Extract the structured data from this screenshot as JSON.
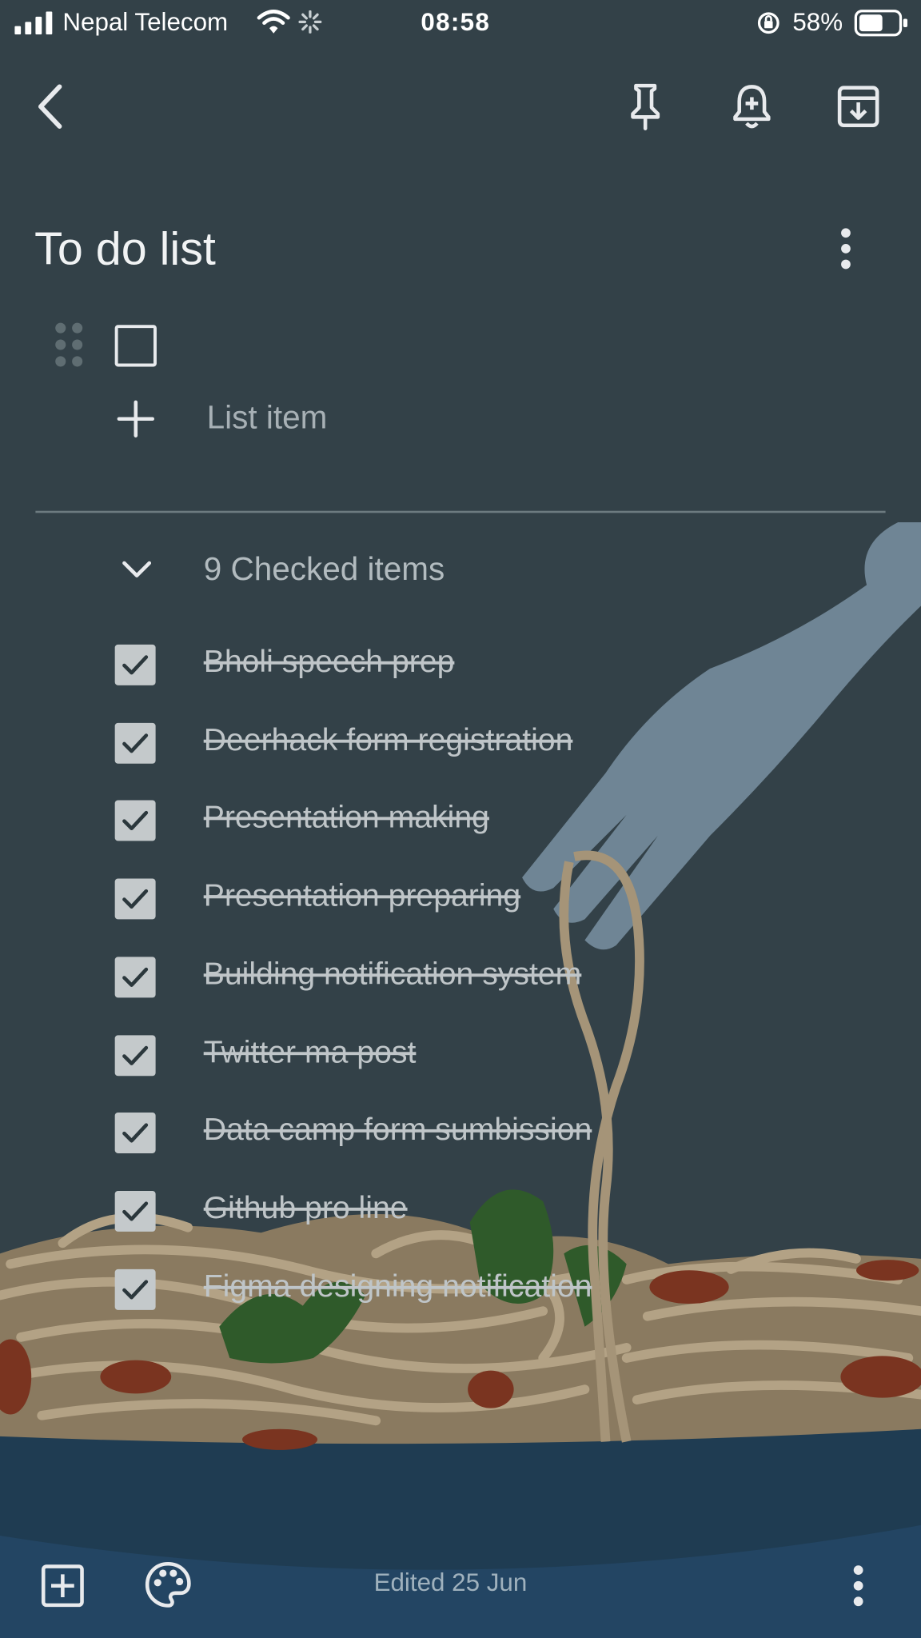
{
  "status_bar": {
    "carrier": "Nepal Telecom",
    "time": "08:58",
    "battery": "58%"
  },
  "toolbar": {
    "icons": [
      "back-arrow-icon",
      "pin-icon",
      "reminder-bell-icon",
      "archive-icon"
    ]
  },
  "note": {
    "title": "To do list",
    "new_item_placeholder": "List item",
    "checked_header": "9 Checked items",
    "checked_items": [
      "Bholi speech prep",
      "Deerhack form registration",
      "Presentation making",
      "Presentation preparing",
      "Building notification system",
      "Twitter ma post",
      "Data camp form sumbission",
      "Github pro line",
      "Figma designing notification"
    ]
  },
  "bottom_bar": {
    "edited": "Edited 25 Jun"
  },
  "colors": {
    "background": "#334148",
    "bottom_dish": "#1f3c52",
    "pasta": "#a59478",
    "fork": "#6f8595"
  }
}
